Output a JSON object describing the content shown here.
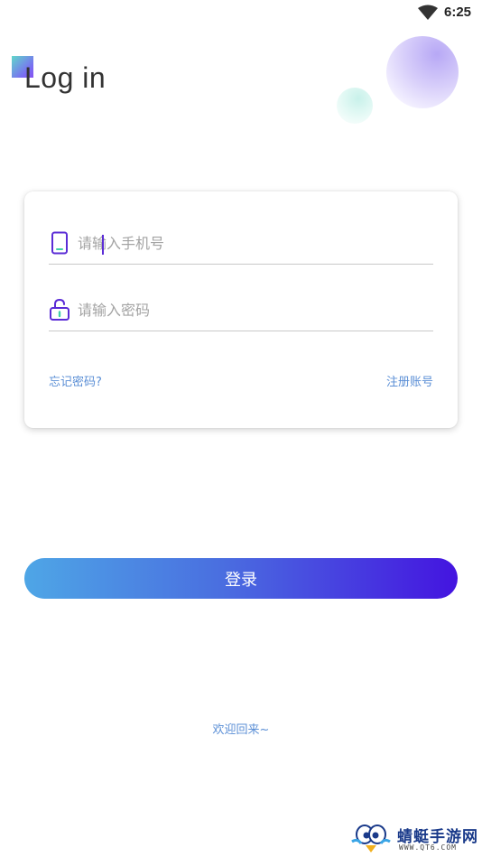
{
  "status_bar": {
    "time": "6:25",
    "wifi_icon": "wifi-icon"
  },
  "header": {
    "title": "Log in"
  },
  "form": {
    "phone": {
      "placeholder": "请输入手机号",
      "value": "",
      "icon": "phone-icon"
    },
    "password": {
      "placeholder": "请输入密码",
      "value": "",
      "icon": "unlock-icon"
    },
    "forgot_label": "忘记密码?",
    "register_label": "注册账号"
  },
  "login_button": {
    "label": "登录"
  },
  "welcome_text": "欢迎回来~",
  "watermark": {
    "name": "蜻蜓手游网",
    "url": "WWW.QT6.COM"
  },
  "colors": {
    "accent": "#5b2cd6",
    "link": "#5b8fd6",
    "button_gradient_start": "#4ea6e6",
    "button_gradient_end": "#4414e0"
  }
}
